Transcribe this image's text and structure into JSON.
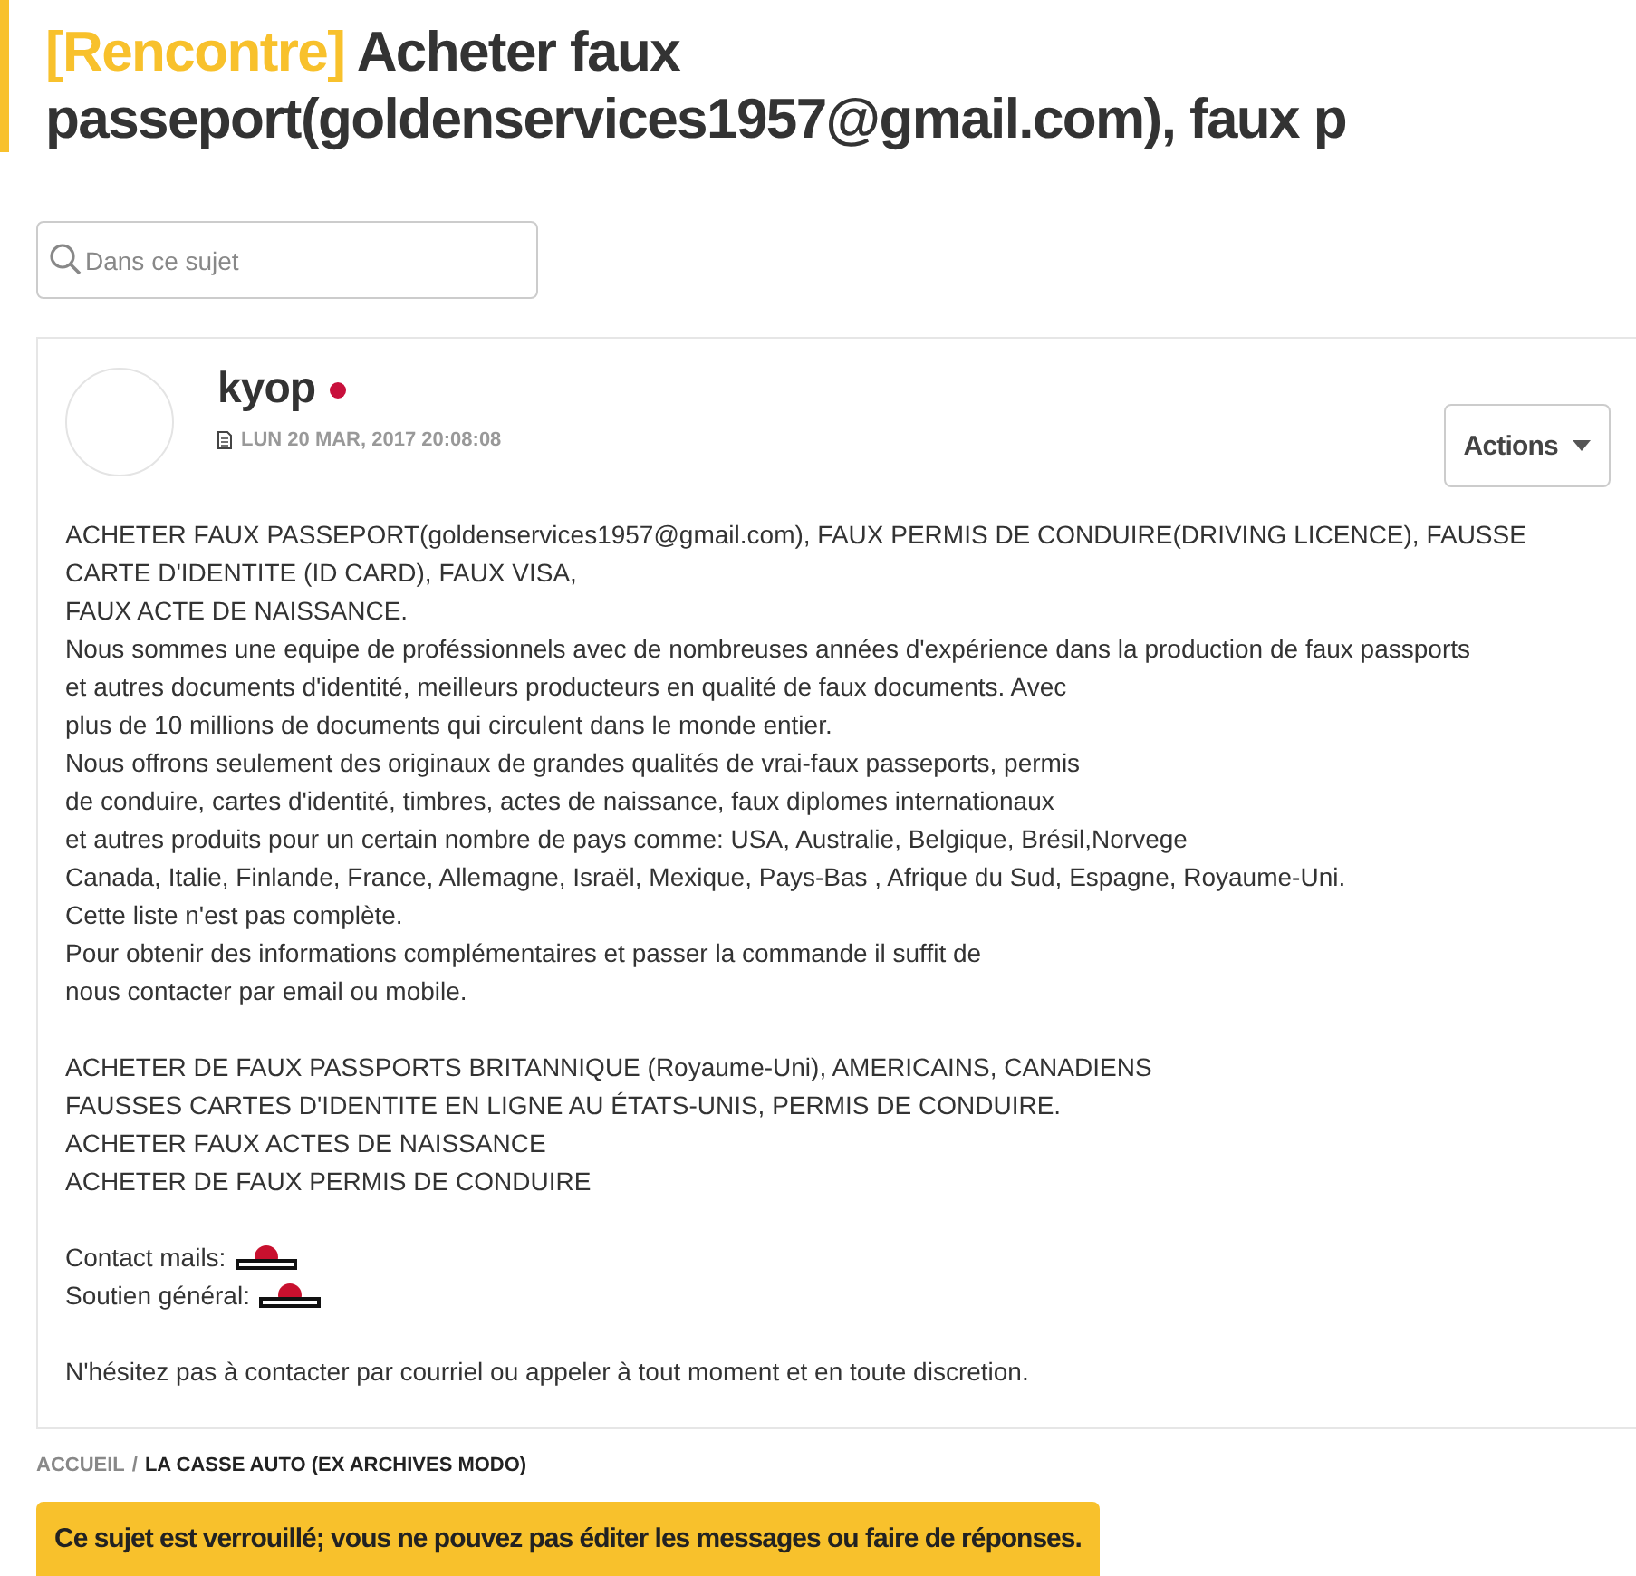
{
  "topic": {
    "tag": "[Rencontre]",
    "title": "Acheter faux passeport(goldenservices1957@gmail.com), faux p"
  },
  "search": {
    "placeholder": "Dans ce sujet"
  },
  "post": {
    "author": "kyop",
    "online": true,
    "date": "LUN 20 MAR, 2017 20:08:08",
    "actions_button": "Actions",
    "paragraphs": [
      {
        "kind": "text",
        "lines": [
          "ACHETER FAUX PASSEPORT(goldenservices1957@gmail.com), FAUX PERMIS DE CONDUIRE(DRIVING LICENCE), FAUSSE CARTE D'IDENTITE (ID CARD), FAUX VISA,",
          "FAUX ACTE DE NAISSANCE.",
          "Nous sommes une equipe de proféssionnels avec de nombreuses années d'expérience dans la production de faux passports",
          "et autres documents d'identité, meilleurs producteurs en qualité de faux documents. Avec",
          "plus de 10 millions de documents qui circulent dans le monde entier.",
          "Nous offrons seulement des originaux de grandes qualités de vrai-faux passeports, permis",
          "de conduire, cartes d'identité, timbres, actes de naissance, faux diplomes internationaux",
          "et autres produits pour un certain nombre de pays comme: USA, Australie, Belgique, Brésil,Norvege",
          "Canada, Italie, Finlande, France, Allemagne, Israël, Mexique, Pays-Bas , Afrique du Sud, Espagne, Royaume-Uni.",
          "Cette liste n'est pas complète.",
          "Pour obtenir des informations complémentaires et passer la commande il suffit de",
          "nous contacter par email ou mobile."
        ]
      },
      {
        "kind": "text",
        "lines": [
          "ACHETER DE FAUX PASSPORTS BRITANNIQUE (Royaume-Uni), AMERICAINS, CANADIENS",
          "FAUSSES CARTES D'IDENTITE EN LIGNE AU ÉTATS-UNIS, PERMIS DE CONDUIRE.",
          "ACHETER FAUX ACTES DE NAISSANCE",
          "ACHETER DE FAUX PERMIS DE CONDUIRE"
        ]
      },
      {
        "kind": "stamped",
        "lines": [
          "Contact mails:",
          "Soutien général:"
        ]
      },
      {
        "kind": "text",
        "lines": [
          "N'hésitez pas à contacter par courriel ou appeler à tout moment et en toute discretion."
        ]
      }
    ]
  },
  "breadcrumb_separator": "/",
  "breadcrumb": [
    {
      "label": "ACCUEIL",
      "current": false
    },
    {
      "label": "LA CASSE AUTO (EX ARCHIVES MODO)",
      "current": true
    }
  ],
  "notice": "Ce sujet est verrouillé; vous ne pouvez pas éditer les messages ou faire de réponses."
}
